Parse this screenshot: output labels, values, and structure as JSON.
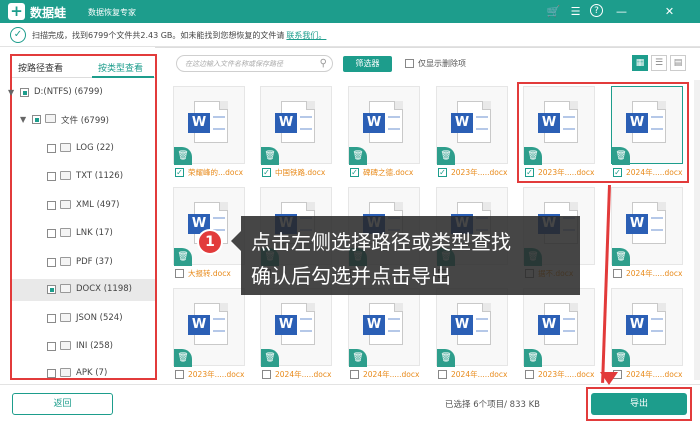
{
  "app": {
    "name": "数据蛙",
    "subtitle": "数据恢复专家"
  },
  "window_controls": [
    "cart-icon",
    "menu-icon",
    "help-icon",
    "minimize-icon",
    "close-icon"
  ],
  "scan": {
    "text": "扫描完成，找到6799个文件共2.43 GB。如未能找到您想恢复的文件请",
    "link": "联系我们。"
  },
  "tabs": {
    "by_path": "按路径查看",
    "by_type": "按类型查看"
  },
  "tree": [
    {
      "label": "D:(NTFS) (6799)",
      "level": 0
    },
    {
      "label": "文件 (6799)",
      "level": 1
    },
    {
      "label": "LOG (22)",
      "level": 2
    },
    {
      "label": "TXT (1126)",
      "level": 2
    },
    {
      "label": "XML (497)",
      "level": 2
    },
    {
      "label": "LNK (17)",
      "level": 2
    },
    {
      "label": "PDF (37)",
      "level": 2
    },
    {
      "label": "DOCX (1198)",
      "level": 2,
      "selected": true
    },
    {
      "label": "JSON (524)",
      "level": 2
    },
    {
      "label": "INI (258)",
      "level": 2
    },
    {
      "label": "APK (7)",
      "level": 2
    }
  ],
  "toolbar": {
    "search_placeholder": "在这边输入文件名称或保存路径",
    "filter": "筛选器",
    "only_deleted": "仅显示删除项"
  },
  "files": [
    {
      "name": "荣耀峰的...docx",
      "checked": true
    },
    {
      "name": "中国铁路.docx",
      "checked": true
    },
    {
      "name": "碑碑之德.docx",
      "checked": true
    },
    {
      "name": "2023年.....docx",
      "checked": true
    },
    {
      "name": "2023年.....docx",
      "checked": true
    },
    {
      "name": "2024年.....docx",
      "checked": true
    },
    {
      "name": "大报转.docx",
      "checked": false
    },
    {
      "name": "",
      "checked": false
    },
    {
      "name": "",
      "checked": false
    },
    {
      "name": "",
      "checked": false
    },
    {
      "name": "据不.docx",
      "checked": false
    },
    {
      "name": "2024年.....docx",
      "checked": false
    },
    {
      "name": "2023年.....docx",
      "checked": false
    },
    {
      "name": "2024年.....docx",
      "checked": false
    },
    {
      "name": "2024年.....docx",
      "checked": false
    },
    {
      "name": "2024年.....docx",
      "checked": false
    },
    {
      "name": "2023年.....docx",
      "checked": false
    },
    {
      "name": "2024年.....docx",
      "checked": false
    }
  ],
  "tooltip": {
    "number": "1",
    "line1": "点击左侧选择路径或类型查找",
    "line2": "确认后勾选并点击导出"
  },
  "bottom": {
    "back": "返回",
    "selected_info": "已选择 6个项目/ 833 KB",
    "export": "导出"
  }
}
